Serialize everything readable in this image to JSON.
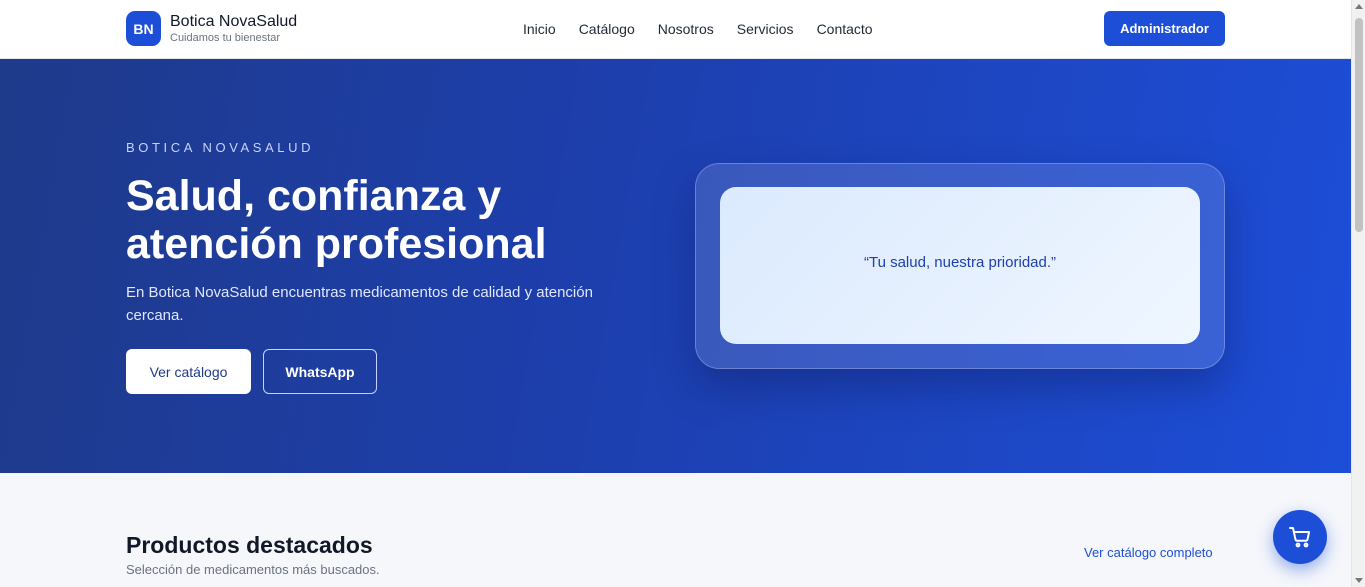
{
  "header": {
    "logo_initials": "BN",
    "brand_name": "Botica NovaSalud",
    "tagline": "Cuidamos tu bienestar",
    "nav": [
      "Inicio",
      "Catálogo",
      "Nosotros",
      "Servicios",
      "Contacto"
    ],
    "admin_label": "Administrador"
  },
  "hero": {
    "eyebrow": "BOTICA NOVASALUD",
    "title_line1": "Salud, confianza y",
    "title_line2": "atención profesional",
    "description": "En Botica NovaSalud encuentras medicamentos de calidad y atención cercana.",
    "catalog_button": "Ver catálogo",
    "whatsapp_button": "WhatsApp",
    "quote": "“Tu salud, nuestra prioridad.”"
  },
  "products": {
    "title": "Productos destacados",
    "subtitle": "Selección de medicamentos más buscados.",
    "link": "Ver catálogo completo"
  },
  "cart": {
    "icon": "cart-icon"
  },
  "colors": {
    "primary": "#1d4ed8",
    "hero_dark": "#1e3a8a",
    "page_bg": "#f5f7fb"
  }
}
